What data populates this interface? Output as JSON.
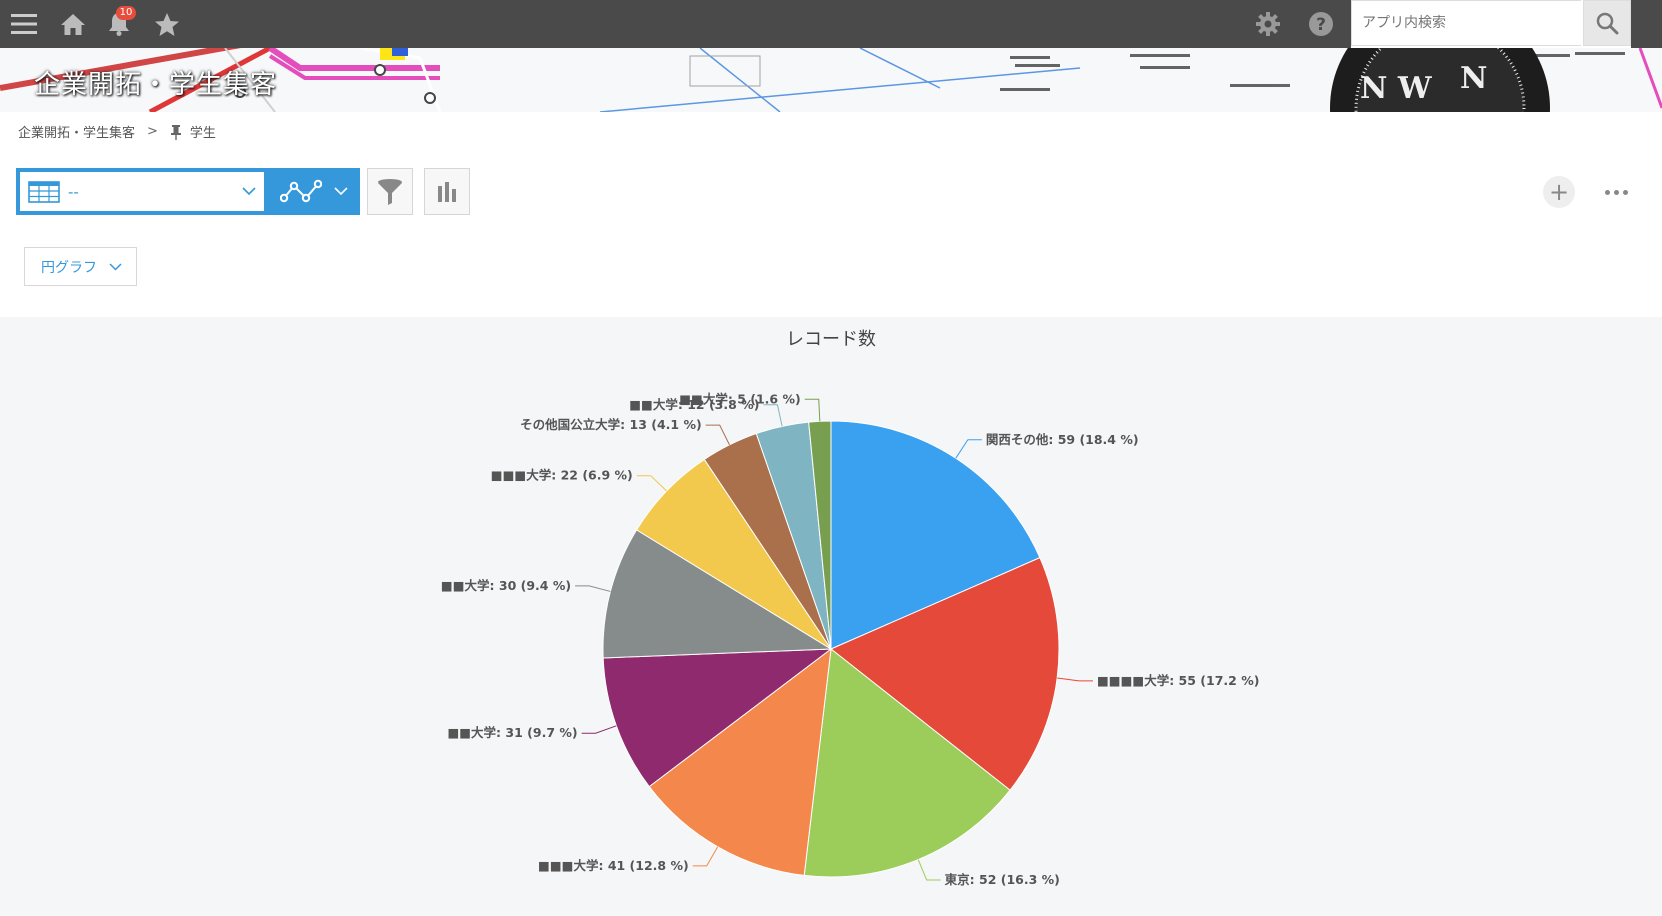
{
  "topbar": {
    "menu_icon": "hamburger-menu-icon",
    "home_icon": "home-icon",
    "notification_icon": "bell-icon",
    "notification_count": "10",
    "favorite_icon": "star-icon",
    "settings_icon": "gear-icon",
    "help_icon": "help-icon",
    "search_placeholder": "アプリ内検索",
    "search_icon": "search-icon"
  },
  "banner": {
    "title": "企業開拓・学生集客"
  },
  "breadcrumb": {
    "space": "企業開拓・学生集客",
    "separator": ">",
    "pin_icon": "pin-icon",
    "app": "学生"
  },
  "toolbar": {
    "view_value": "--",
    "view_icon": "table-icon",
    "graph_icon": "graph-icon",
    "filter_icon": "filter-icon",
    "aggregate_icon": "bar-chart-icon"
  },
  "chart_type_label": "円グラフ",
  "colors": {
    "accent": "#3498db",
    "topbar": "#4a4a4a",
    "chart_bg": "#f4f6f7"
  },
  "chart_data": {
    "type": "pie",
    "title": "レコード数",
    "slices": [
      {
        "label": "関西その他",
        "value": 59,
        "percent": "18.4 %",
        "color": "#3aa0f0"
      },
      {
        "label": "■■■■大学",
        "value": 55,
        "percent": "17.2 %",
        "color": "#e5493a"
      },
      {
        "label": "東京",
        "value": 52,
        "percent": "16.3 %",
        "color": "#9ccc5a"
      },
      {
        "label": "■■■大学",
        "value": 41,
        "percent": "12.8 %",
        "color": "#f4874b"
      },
      {
        "label": "■■大学",
        "value": 31,
        "percent": "9.7 %",
        "color": "#8e2a6d"
      },
      {
        "label": "■■大学",
        "value": 30,
        "percent": "9.4 %",
        "color": "#868b8b"
      },
      {
        "label": "■■■大学",
        "value": 22,
        "percent": "6.9 %",
        "color": "#f2c94c"
      },
      {
        "label": "その他国公立大学",
        "value": 13,
        "percent": "4.1 %",
        "color": "#a9704b"
      },
      {
        "label": "■■大学",
        "value": 12,
        "percent": "3.8 %",
        "color": "#7fb5c2"
      },
      {
        "label": "■■大学",
        "value": 5,
        "percent": "1.6 %",
        "color": "#779f4f"
      }
    ]
  }
}
